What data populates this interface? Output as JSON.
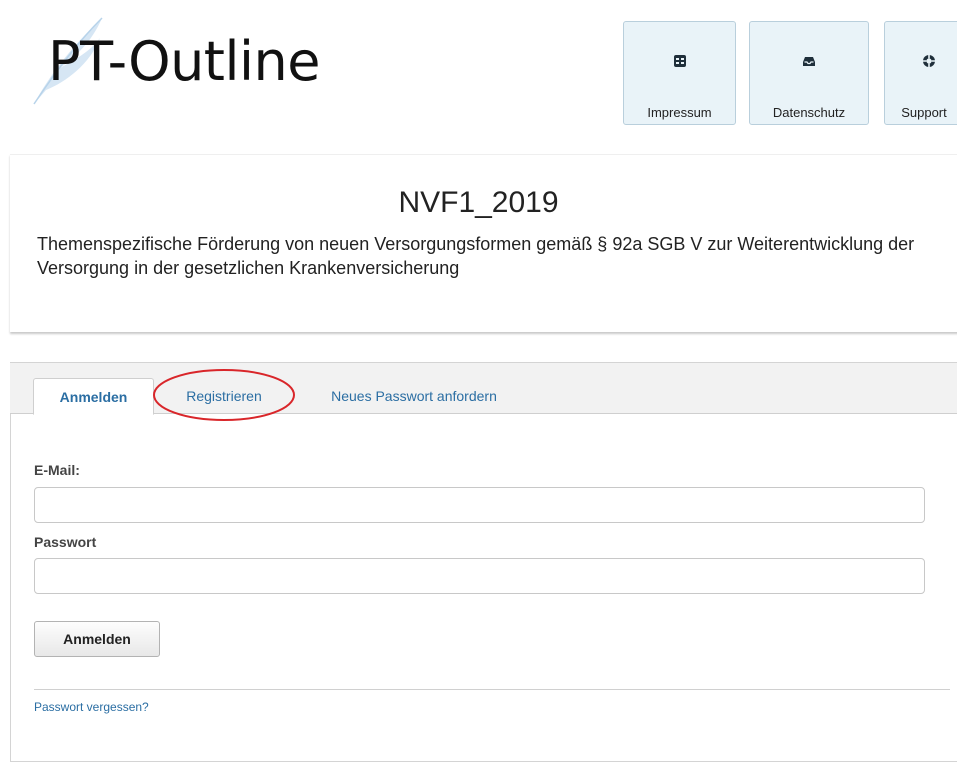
{
  "logo": {
    "text": "PT-Outline"
  },
  "nav": [
    {
      "label": "Impressum",
      "icon": "building-icon"
    },
    {
      "label": "Datenschutz",
      "icon": "inbox-tray-icon"
    },
    {
      "label": "Support",
      "icon": "lifebuoy-icon"
    }
  ],
  "project": {
    "title": "NVF1_2019",
    "description": "Themenspezifische Förderung von neuen Versorgungsformen gemäß § 92a SGB V zur Weiterentwicklung der Versorgung in der gesetzlichen Krankenversicherung"
  },
  "tabs": [
    {
      "label": "Anmelden",
      "active": true
    },
    {
      "label": "Registrieren",
      "active": false,
      "highlighted": true
    },
    {
      "label": "Neues Passwort anfordern",
      "active": false
    }
  ],
  "form": {
    "email_label": "E-Mail:",
    "email_value": "",
    "password_label": "Passwort",
    "password_value": "",
    "submit_label": "Anmelden",
    "forgot_label": "Passwort vergessen?"
  },
  "colors": {
    "accent": "#2b6ea3",
    "nav_bg": "#e9f3f8",
    "highlight_ring": "#d9262a"
  }
}
